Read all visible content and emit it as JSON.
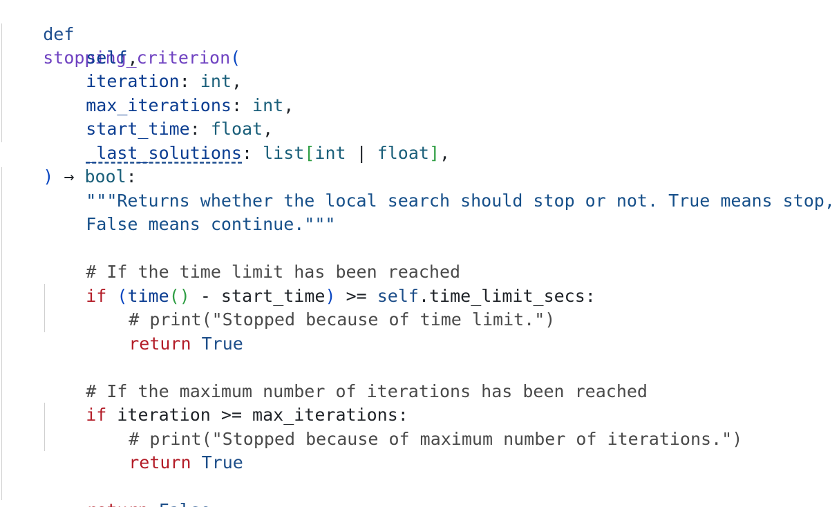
{
  "code": {
    "def_kw": "def",
    "func_name": "stopping_criterion",
    "open_paren": "(",
    "params": [
      {
        "name": "self",
        "sep": ":",
        "type": "",
        "trail": ","
      },
      {
        "name": "iteration",
        "sep": ": ",
        "type": "int",
        "trail": ","
      },
      {
        "name": "max_iterations",
        "sep": ": ",
        "type": "int",
        "trail": ","
      },
      {
        "name": "start_time",
        "sep": ": ",
        "type": "float",
        "trail": ","
      }
    ],
    "last_param": {
      "name": "_last_solutions",
      "sep": ": ",
      "type_list": "list",
      "bracket_open": "[",
      "type_a": "int",
      "pipe": " | ",
      "type_b": "float",
      "bracket_close": "]",
      "trail": ","
    },
    "close_paren": ")",
    "arrow": " → ",
    "return_type": "bool",
    "colon": ":",
    "docstring_line1": "\"\"\"Returns whether the local search should stop or not. True means stop,",
    "docstring_line2": "False means continue.\"\"\"",
    "comment_time": "# If the time limit has been reached",
    "if_kw": "if",
    "time_call": "time",
    "time_parens": "()",
    "time_rest": " - start_time",
    "time_cmp": " >= ",
    "self_kw": "self",
    "time_attr": ".time_limit_secs:",
    "comment_print_time": "# print(\"Stopped because of time limit.\")",
    "return_kw": "return",
    "true_val": "True",
    "false_val": "False",
    "comment_iter": "# If the maximum number of iterations has been reached",
    "iter_cond": " iteration >= max_iterations:",
    "comment_print_iter": "# print(\"Stopped because of maximum number of iterations.\")"
  }
}
